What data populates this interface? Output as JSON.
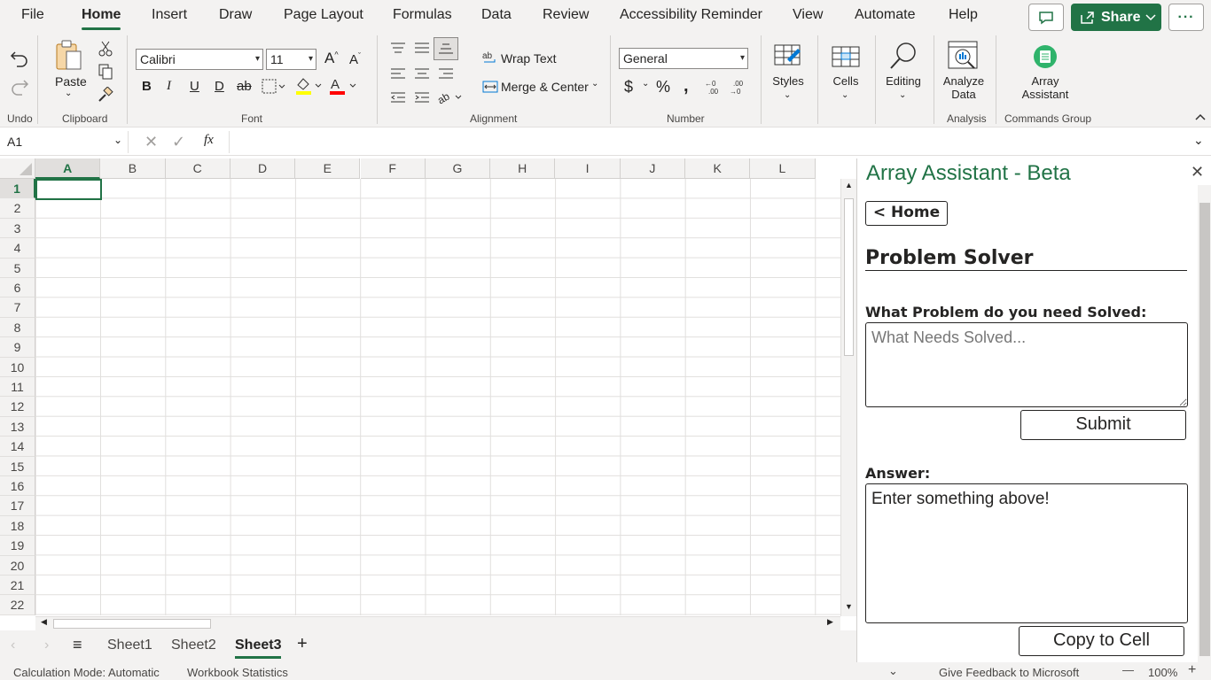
{
  "menu": {
    "tabs": [
      "File",
      "Home",
      "Insert",
      "Draw",
      "Page Layout",
      "Formulas",
      "Data",
      "Review",
      "Accessibility Reminder",
      "View",
      "Automate",
      "Help"
    ],
    "share_label": "Share"
  },
  "ribbon": {
    "groups": {
      "undo": "Undo",
      "clipboard": "Clipboard",
      "font": "Font",
      "alignment": "Alignment",
      "number": "Number",
      "analysis": "Analysis",
      "commands": "Commands Group"
    },
    "paste_label": "Paste",
    "font_name": "Calibri",
    "font_size": "11",
    "wrap_text": "Wrap Text",
    "merge_center": "Merge & Center",
    "number_format": "General",
    "styles": "Styles",
    "cells": "Cells",
    "editing": "Editing",
    "analyze_data_line1": "Analyze",
    "analyze_data_line2": "Data",
    "array_assistant_line1": "Array",
    "array_assistant_line2": "Assistant",
    "colors": {
      "fill_color": "#ffff00",
      "font_color": "#ff0000",
      "accent": "#217346"
    }
  },
  "formula_bar": {
    "name_box": "A1",
    "fx": "fx",
    "value": ""
  },
  "grid": {
    "columns": [
      "A",
      "B",
      "C",
      "D",
      "E",
      "F",
      "G",
      "H",
      "I",
      "J",
      "K",
      "L"
    ],
    "rows": [
      "1",
      "2",
      "3",
      "4",
      "5",
      "6",
      "7",
      "8",
      "9",
      "10",
      "11",
      "12",
      "13",
      "14",
      "15",
      "16",
      "17",
      "18",
      "19",
      "20",
      "21",
      "22"
    ],
    "selected_cell": "A1"
  },
  "sheets": {
    "tabs": [
      "Sheet1",
      "Sheet2",
      "Sheet3"
    ],
    "active": "Sheet3"
  },
  "statusbar": {
    "calc_mode": "Calculation Mode: Automatic",
    "workbook_stats": "Workbook Statistics",
    "feedback": "Give Feedback to Microsoft",
    "zoom": "100%"
  },
  "pane": {
    "title": "Array Assistant - Beta",
    "home_button": "< Home",
    "heading": "Problem Solver",
    "question_label": "What Problem do you need Solved:",
    "question_placeholder": "What Needs Solved...",
    "question_value": "",
    "submit_label": "Submit",
    "answer_label": "Answer:",
    "answer_value": "Enter something above!",
    "copy_label": "Copy to Cell"
  }
}
